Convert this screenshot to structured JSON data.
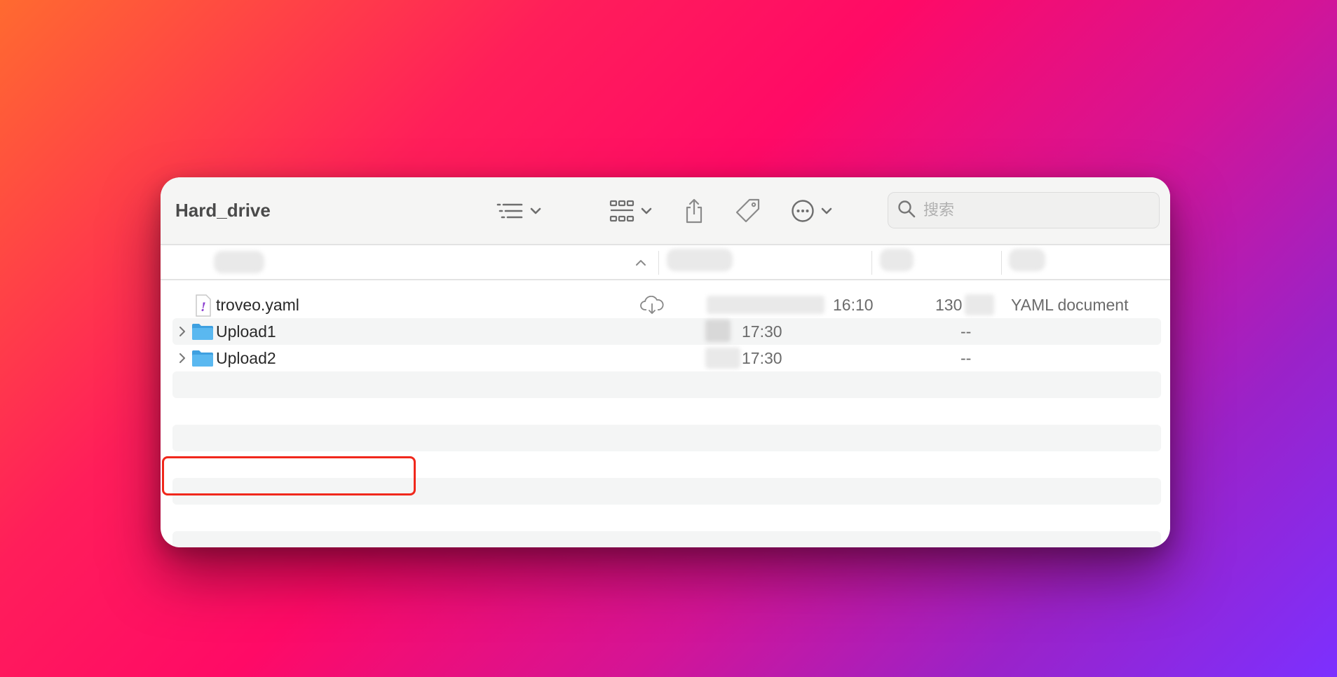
{
  "window": {
    "title": "Hard_drive"
  },
  "toolbar": {
    "list_view": "list-view-icon",
    "grid_view": "grid-view-icon",
    "share": "share-icon",
    "tags": "tag-icon",
    "more": "more-icon"
  },
  "search": {
    "placeholder": "搜索"
  },
  "files": [
    {
      "name": "troveo.yaml",
      "icon": "yaml-file-icon",
      "status_icon": "icloud-download-icon",
      "time": "16:10",
      "size": "130",
      "kind": "YAML document",
      "selected": true
    },
    {
      "name": "Upload1",
      "icon": "folder-icon",
      "time": "17:30",
      "size": "--",
      "kind": ""
    },
    {
      "name": "Upload2",
      "icon": "folder-icon",
      "time": "17:30",
      "size": "--",
      "kind": ""
    }
  ],
  "colors": {
    "selection": "#f0281c",
    "folder": "#5ab8f0",
    "yaml": "#8a3cd0"
  }
}
